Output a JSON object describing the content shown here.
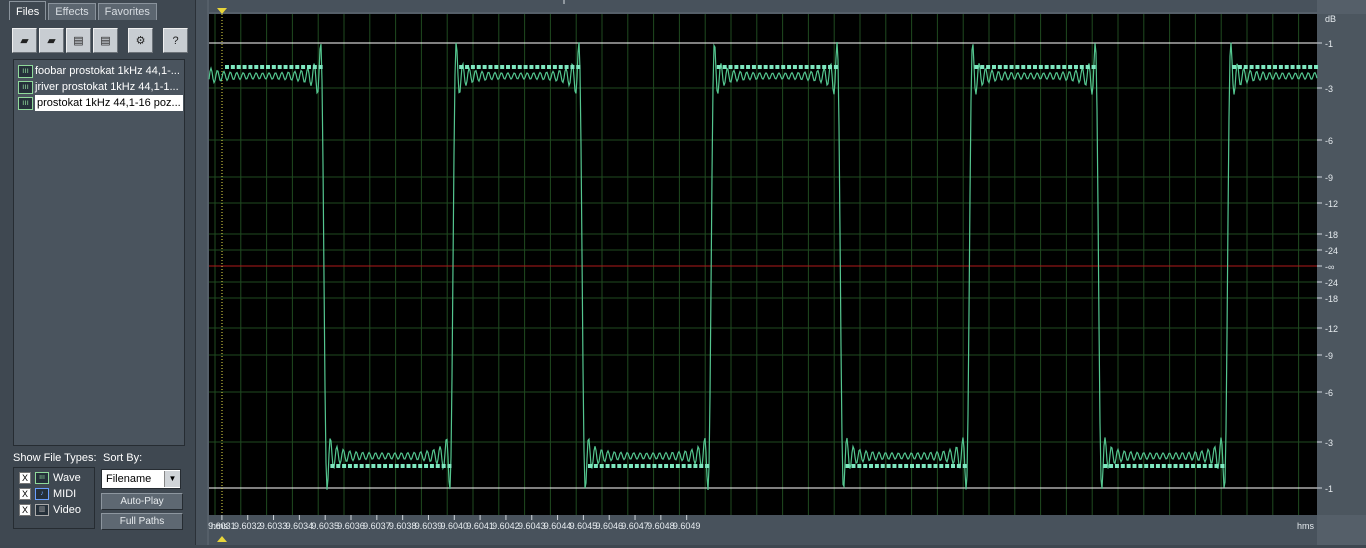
{
  "tabs": [
    "Files",
    "Effects",
    "Favorites"
  ],
  "toolbar": [
    {
      "name": "open-file-icon",
      "glyph": "▰"
    },
    {
      "name": "open-folder-icon",
      "glyph": "▰"
    },
    {
      "name": "insert-icon",
      "glyph": "▤"
    },
    {
      "name": "close-file-icon",
      "glyph": "▤"
    },
    {
      "name": "settings-icon",
      "glyph": "⚙"
    },
    {
      "name": "help-icon",
      "glyph": "?"
    }
  ],
  "files": [
    {
      "label": "foobar prostokat 1kHz 44,1-...",
      "selected": false
    },
    {
      "label": "jriver prostokat 1kHz 44,1-1...",
      "selected": false
    },
    {
      "label": "prostokat 1kHz 44,1-16 poz...",
      "selected": true
    }
  ],
  "show_types": {
    "title": "Show File Types:",
    "items": [
      {
        "label": "Wave",
        "checked": "X"
      },
      {
        "label": "MIDI",
        "checked": "X"
      },
      {
        "label": "Video",
        "checked": "X"
      }
    ]
  },
  "sort": {
    "title": "Sort By:",
    "value": "Filename",
    "options": [
      "Filename"
    ]
  },
  "buttons": {
    "autoplay": "Auto-Play",
    "fullpaths": "Full Paths"
  },
  "ruler": {
    "unit_left": "hms",
    "unit_right": "hms",
    "ticks": [
      "9.6031",
      "9.6032",
      "9.6033",
      "9.6034",
      "9.6035",
      "9.6036",
      "9.6037",
      "9.6038",
      "9.6039",
      "9.6040",
      "9.6041",
      "9.6042",
      "9.6043",
      "9.6044",
      "9.6045",
      "9.6046",
      "9.6047",
      "9.6048",
      "9.6049"
    ]
  },
  "db_scale": {
    "unit": "dB",
    "labels": [
      "-1",
      "-3",
      "-6",
      "-9",
      "-12",
      "-18",
      "-24",
      "-∞",
      "-24",
      "-18",
      "-12",
      "-9",
      "-6",
      "-3",
      "-1"
    ]
  },
  "colors": {
    "waveform": "#54c68f",
    "samples": "#7ee7c0",
    "center": "#b11a1a",
    "clip": "#ffffff",
    "grid": "#1f4a20",
    "background": "#000000"
  },
  "waveform": {
    "type": "square",
    "frequency_hz": 1000,
    "sample_rate_hz": 44100
  }
}
